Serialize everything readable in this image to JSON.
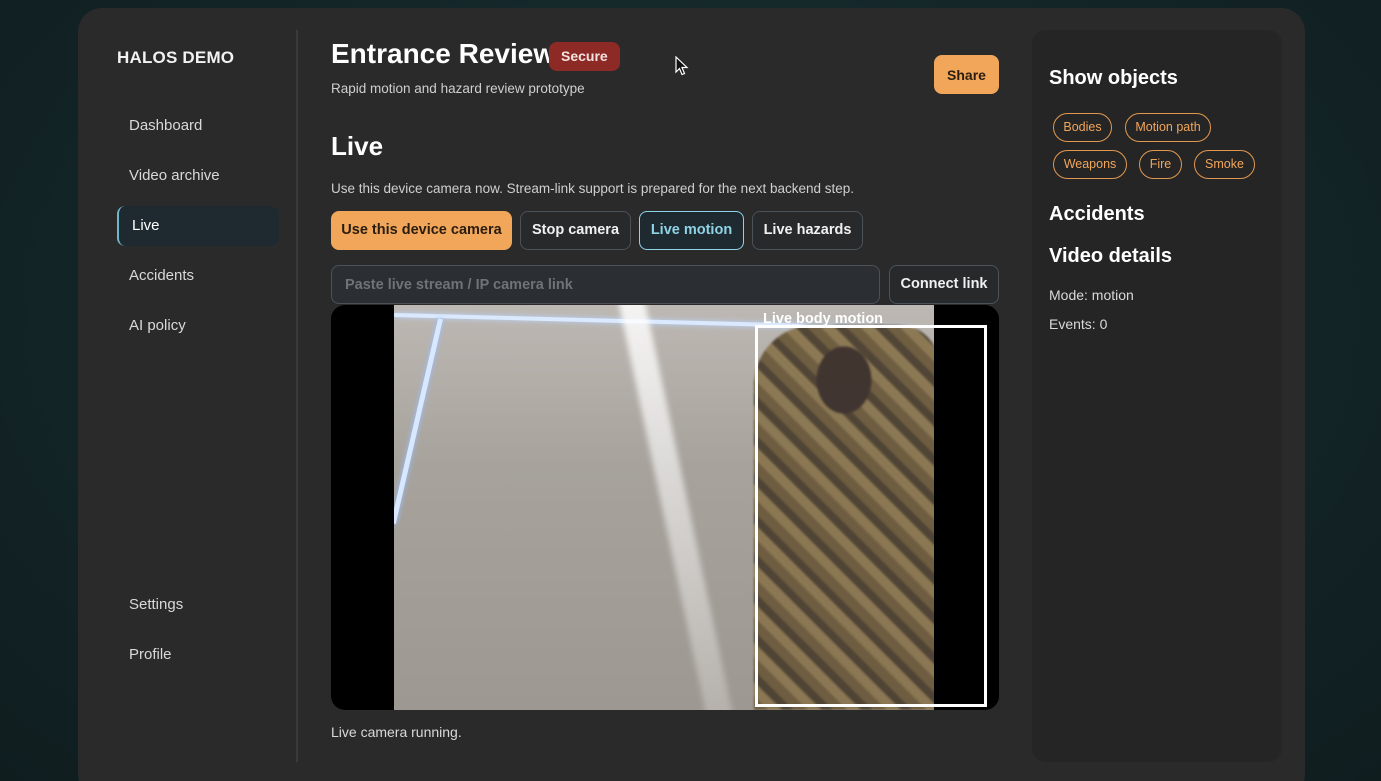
{
  "sidebar": {
    "brand": "HALOS DEMO",
    "nav_items": [
      {
        "label": "Dashboard",
        "active": false
      },
      {
        "label": "Video archive",
        "active": false
      },
      {
        "label": "Live",
        "active": true
      },
      {
        "label": "Accidents",
        "active": false
      },
      {
        "label": "AI policy",
        "active": false
      }
    ],
    "bottom_items": [
      {
        "label": "Settings"
      },
      {
        "label": "Profile"
      }
    ]
  },
  "header": {
    "title": "Entrance Review",
    "badge": "Secure",
    "subtitle": "Rapid motion and hazard review prototype",
    "share_label": "Share"
  },
  "live": {
    "title": "Live",
    "description": "Use this device camera now. Stream-link support is prepared for the next backend step.",
    "buttons": {
      "use_camera": "Use this device camera",
      "stop_camera": "Stop camera",
      "live_motion": "Live motion",
      "live_hazards": "Live hazards"
    },
    "stream_input": {
      "value": "",
      "placeholder": "Paste live stream / IP camera link"
    },
    "connect_label": "Connect link",
    "detection_label": "Live body motion",
    "status": "Live camera running."
  },
  "panel": {
    "show_objects_title": "Show objects",
    "chips": [
      "Bodies",
      "Motion path",
      "Weapons",
      "Fire",
      "Smoke"
    ],
    "accidents_title": "Accidents",
    "video_details_title": "Video details",
    "mode": "Mode: motion",
    "events": "Events: 0"
  },
  "colors": {
    "accent_orange": "#f2a65a",
    "selected_cyan": "#8fd3e6",
    "badge_red": "#8e2a26"
  }
}
